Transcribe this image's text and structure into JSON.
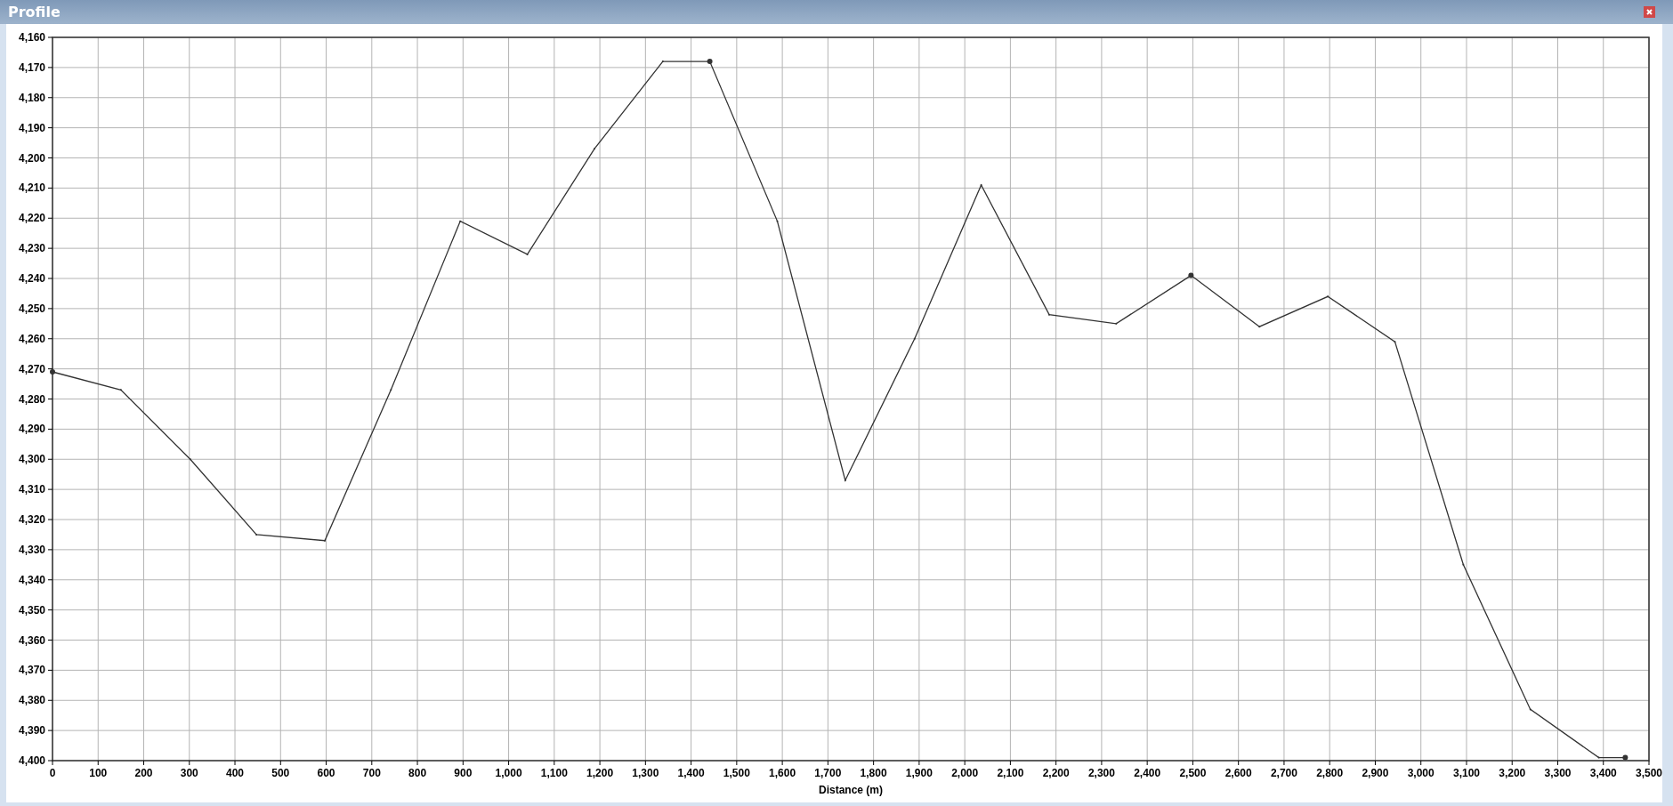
{
  "window": {
    "title": "Profile"
  },
  "chart_data": {
    "type": "line",
    "grid": true,
    "xlabel": "Distance (m)",
    "xlim": [
      0,
      3500
    ],
    "ylim": [
      4400,
      4160
    ],
    "xticks": [
      {
        "value": 0,
        "label": "0"
      },
      {
        "value": 100,
        "label": "100"
      },
      {
        "value": 200,
        "label": "200"
      },
      {
        "value": 300,
        "label": "300"
      },
      {
        "value": 400,
        "label": "400"
      },
      {
        "value": 500,
        "label": "500"
      },
      {
        "value": 600,
        "label": "600"
      },
      {
        "value": 700,
        "label": "700"
      },
      {
        "value": 800,
        "label": "800"
      },
      {
        "value": 900,
        "label": "900"
      },
      {
        "value": 1000,
        "label": "1,000"
      },
      {
        "value": 1100,
        "label": "1,100"
      },
      {
        "value": 1200,
        "label": "1,200"
      },
      {
        "value": 1300,
        "label": "1,300"
      },
      {
        "value": 1400,
        "label": "1,400"
      },
      {
        "value": 1500,
        "label": "1,500"
      },
      {
        "value": 1600,
        "label": "1,600"
      },
      {
        "value": 1700,
        "label": "1,700"
      },
      {
        "value": 1800,
        "label": "1,800"
      },
      {
        "value": 1900,
        "label": "1,900"
      },
      {
        "value": 2000,
        "label": "2,000"
      },
      {
        "value": 2100,
        "label": "2,100"
      },
      {
        "value": 2200,
        "label": "2,200"
      },
      {
        "value": 2300,
        "label": "2,300"
      },
      {
        "value": 2400,
        "label": "2,400"
      },
      {
        "value": 2500,
        "label": "2,500"
      },
      {
        "value": 2600,
        "label": "2,600"
      },
      {
        "value": 2700,
        "label": "2,700"
      },
      {
        "value": 2800,
        "label": "2,800"
      },
      {
        "value": 2900,
        "label": "2,900"
      },
      {
        "value": 3000,
        "label": "3,000"
      },
      {
        "value": 3100,
        "label": "3,100"
      },
      {
        "value": 3200,
        "label": "3,200"
      },
      {
        "value": 3300,
        "label": "3,300"
      },
      {
        "value": 3400,
        "label": "3,400"
      },
      {
        "value": 3500,
        "label": "3,500"
      }
    ],
    "yticks": [
      {
        "value": 4160,
        "label": "4,160"
      },
      {
        "value": 4170,
        "label": "4,170"
      },
      {
        "value": 4180,
        "label": "4,180"
      },
      {
        "value": 4190,
        "label": "4,190"
      },
      {
        "value": 4200,
        "label": "4,200"
      },
      {
        "value": 4210,
        "label": "4,210"
      },
      {
        "value": 4220,
        "label": "4,220"
      },
      {
        "value": 4230,
        "label": "4,230"
      },
      {
        "value": 4240,
        "label": "4,240"
      },
      {
        "value": 4250,
        "label": "4,250"
      },
      {
        "value": 4260,
        "label": "4,260"
      },
      {
        "value": 4270,
        "label": "4,270"
      },
      {
        "value": 4280,
        "label": "4,280"
      },
      {
        "value": 4290,
        "label": "4,290"
      },
      {
        "value": 4300,
        "label": "4,300"
      },
      {
        "value": 4310,
        "label": "4,310"
      },
      {
        "value": 4320,
        "label": "4,320"
      },
      {
        "value": 4330,
        "label": "4,330"
      },
      {
        "value": 4340,
        "label": "4,340"
      },
      {
        "value": 4350,
        "label": "4,350"
      },
      {
        "value": 4360,
        "label": "4,360"
      },
      {
        "value": 4370,
        "label": "4,370"
      },
      {
        "value": 4380,
        "label": "4,380"
      },
      {
        "value": 4390,
        "label": "4,390"
      },
      {
        "value": 4400,
        "label": "4,400"
      }
    ],
    "x": [
      0,
      150,
      302,
      447,
      597,
      742,
      894,
      1041,
      1188,
      1338,
      1441,
      1589,
      1738,
      1890,
      2036,
      2185,
      2332,
      2496,
      2646,
      2796,
      2943,
      3093,
      3240,
      3390,
      3448
    ],
    "series": [
      {
        "color": "#333333",
        "values": [
          4271,
          4277,
          4300,
          4325,
          4327,
          4277,
          4221,
          4232,
          4197,
          4168,
          4168,
          4221,
          4307,
          4260,
          4209,
          4252,
          4255,
          4239,
          4256,
          4246,
          4261,
          4335,
          4383,
          4399,
          4399
        ]
      }
    ]
  },
  "vertices": [
    {
      "marked": true
    },
    {
      "marked": false
    },
    {
      "marked": false
    },
    {
      "marked": false
    },
    {
      "marked": false
    },
    {
      "marked": false
    },
    {
      "marked": false
    },
    {
      "marked": false
    },
    {
      "marked": false
    },
    {
      "marked": false
    },
    {
      "marked": true
    },
    {
      "marked": false
    },
    {
      "marked": false
    },
    {
      "marked": false
    },
    {
      "marked": false
    },
    {
      "marked": false
    },
    {
      "marked": false
    },
    {
      "marked": true
    },
    {
      "marked": false
    },
    {
      "marked": false
    },
    {
      "marked": false
    },
    {
      "marked": false
    },
    {
      "marked": false
    },
    {
      "marked": false
    },
    {
      "marked": true
    }
  ]
}
